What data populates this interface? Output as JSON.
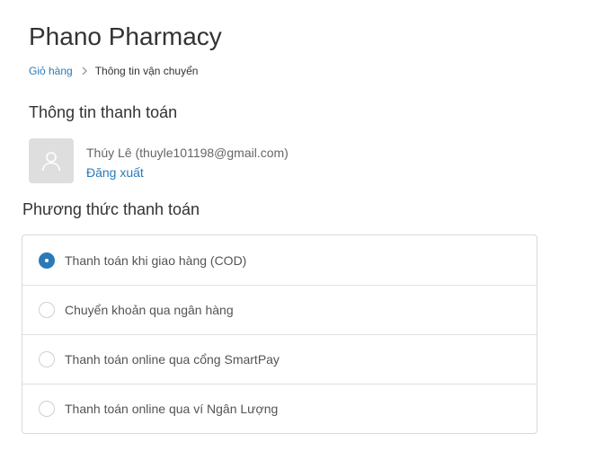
{
  "header": {
    "shop_name": "Phano Pharmacy"
  },
  "breadcrumb": {
    "items": [
      {
        "label": "Giỏ hàng",
        "link": true
      },
      {
        "label": "Thông tin vận chuyển",
        "link": false
      }
    ]
  },
  "billing": {
    "section_title": "Thông tin thanh toán",
    "user_text": "Thúy Lê (thuyle101198@gmail.com)",
    "logout_label": "Đăng xuất"
  },
  "payment": {
    "section_title": "Phương thức thanh toán",
    "methods": [
      {
        "label": "Thanh toán khi giao hàng (COD)",
        "selected": true
      },
      {
        "label": "Chuyển khoản qua ngân hàng",
        "selected": false
      },
      {
        "label": "Thanh toán online qua cổng SmartPay",
        "selected": false
      },
      {
        "label": "Thanh toán online qua ví Ngân Lượng",
        "selected": false
      }
    ]
  },
  "colors": {
    "accent": "#2a7ab8",
    "text": "#333333",
    "muted_text": "#545454",
    "border": "#d9d9d9",
    "avatar_bg": "#dedede"
  }
}
